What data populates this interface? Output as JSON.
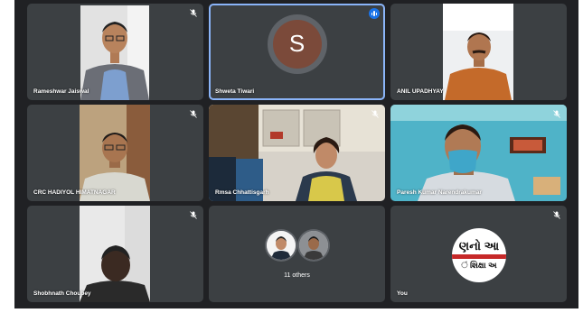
{
  "meeting": {
    "participants": [
      {
        "name": "Rameshwar Jaiswal",
        "mic": "muted"
      },
      {
        "name": "Shweta Tiwari",
        "avatar_letter": "S",
        "mic": "speaking"
      },
      {
        "name": "ANIL UPADHYAY",
        "mic": "none"
      },
      {
        "name": "CRC HADIYOL HIMATNAGAR",
        "mic": "muted"
      },
      {
        "name": "Rmsa Chhattisgarh",
        "mic": "muted"
      },
      {
        "name": "Paresh Kumar Narendrakumar",
        "mic": "muted"
      },
      {
        "name": "Shobhnath Choubey",
        "mic": "muted"
      },
      {
        "name": "",
        "others_label": "11 others",
        "mic": "none"
      },
      {
        "name": "You",
        "logo_line1": "ણનો આ",
        "logo_line2": "ં શિક્ષા અ",
        "mic": "muted"
      }
    ]
  },
  "colors": {
    "background": "#202124",
    "tile": "#3c4043",
    "active_speaker_border": "#8ab4f8",
    "speaking_indicator": "#1a73e8",
    "avatar_s": "#7b4a3a"
  }
}
